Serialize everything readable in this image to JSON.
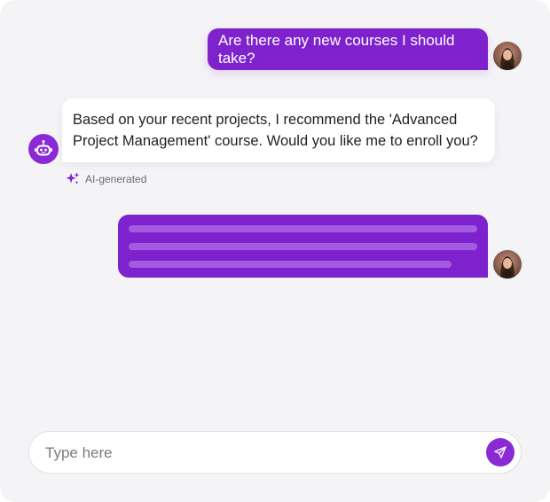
{
  "messages": [
    {
      "role": "user",
      "text": "Are there any new courses I should take?",
      "avatar_icon": "user-portrait-icon"
    },
    {
      "role": "assistant",
      "text": "Based on your recent projects, I recommend the 'Advanced Project Management' course. Would you like me to enroll you?",
      "avatar_icon": "robot-icon",
      "tag": {
        "icon": "sparkle-icon",
        "label": "AI-generated"
      }
    },
    {
      "role": "user",
      "loading": true,
      "avatar_icon": "user-portrait-icon"
    }
  ],
  "composer": {
    "placeholder": "Type here",
    "send_icon": "send-icon"
  },
  "colors": {
    "accent": "#7e22ce",
    "accent_light": "#a35ce0",
    "background": "#f4f4f6",
    "bot_bubble": "#ffffff",
    "text_primary": "#1f1f24",
    "text_muted": "#6b6b72"
  }
}
